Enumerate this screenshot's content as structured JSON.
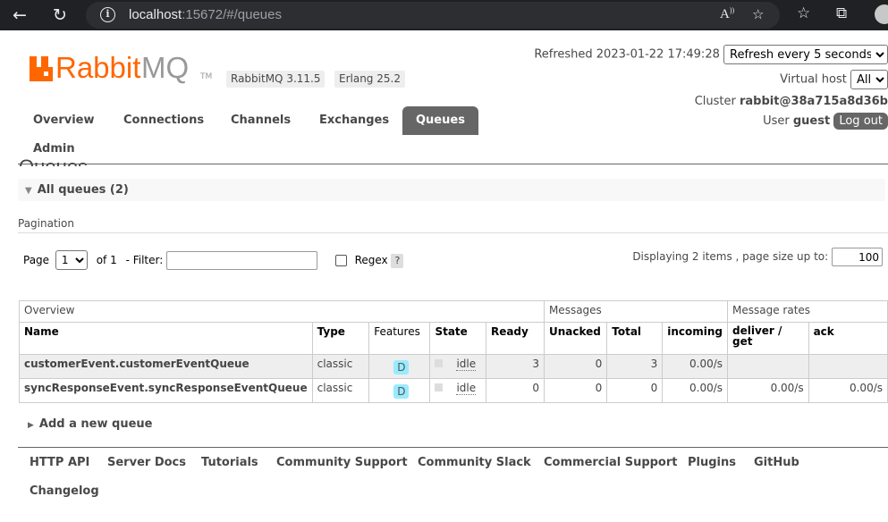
{
  "browser": {
    "url_host": "localhost",
    "url_rest": ":15672/#/queues"
  },
  "header": {
    "logo_rabbit": "Rabbit",
    "logo_mq": "MQ",
    "logo_tm": "TM",
    "rabbitmq_version": "RabbitMQ 3.11.5",
    "erlang_version": "Erlang 25.2",
    "refreshed_label": "Refreshed 2023-01-22 17:49:28",
    "refresh_select": "Refresh every 5 seconds",
    "vhost_label": "Virtual host",
    "vhost_select": "All",
    "cluster_label": "Cluster",
    "cluster_name": "rabbit@38a715a8d36b",
    "user_label": "User",
    "user_name": "guest",
    "logout_label": "Log out"
  },
  "nav": {
    "overview": "Overview",
    "connections": "Connections",
    "channels": "Channels",
    "exchanges": "Exchanges",
    "queues": "Queues",
    "admin": "Admin"
  },
  "page": {
    "title": "Queues",
    "section_title": "All queues (2)",
    "pagination_label": "Pagination",
    "page_label": "Page",
    "page_value": "1",
    "of_label": "of 1",
    "filter_label": "- Filter:",
    "filter_value": "",
    "regex_label": "Regex",
    "help_label": "?",
    "displaying_label": "Displaying 2 items , page size up to:",
    "page_size": "100",
    "add_queue_label": "Add a new queue"
  },
  "table": {
    "group_headers": {
      "overview": "Overview",
      "messages": "Messages",
      "rates": "Message rates"
    },
    "columns": {
      "name": "Name",
      "type": "Type",
      "features": "Features",
      "state": "State",
      "ready": "Ready",
      "unacked": "Unacked",
      "total": "Total",
      "incoming": "incoming",
      "deliver_get": "deliver / get",
      "ack": "ack"
    },
    "rows": [
      {
        "name": "customerEvent.customerEventQueue",
        "type": "classic",
        "features": "D",
        "state": "idle",
        "ready": "3",
        "unacked": "0",
        "total": "3",
        "incoming": "0.00/s",
        "deliver_get": "",
        "ack": ""
      },
      {
        "name": "syncResponseEvent.syncResponseEventQueue",
        "type": "classic",
        "features": "D",
        "state": "idle",
        "ready": "0",
        "unacked": "0",
        "total": "0",
        "incoming": "0.00/s",
        "deliver_get": "0.00/s",
        "ack": "0.00/s"
      }
    ]
  },
  "footer": {
    "http_api": "HTTP API",
    "server_docs": "Server Docs",
    "tutorials": "Tutorials",
    "community_support": "Community Support",
    "community_slack": "Community Slack",
    "commercial_support": "Commercial Support",
    "plugins": "Plugins",
    "github": "GitHub",
    "changelog": "Changelog"
  },
  "colors": {
    "brand_orange": "#ff6600",
    "tab_active": "#666666",
    "durable_badge": "#99ebff"
  },
  "icons": [
    "back-arrow-icon",
    "reload-icon",
    "info-icon",
    "read-aloud-icon",
    "favorite-add-icon",
    "favorites-icon",
    "collections-icon",
    "profile-icon"
  ]
}
